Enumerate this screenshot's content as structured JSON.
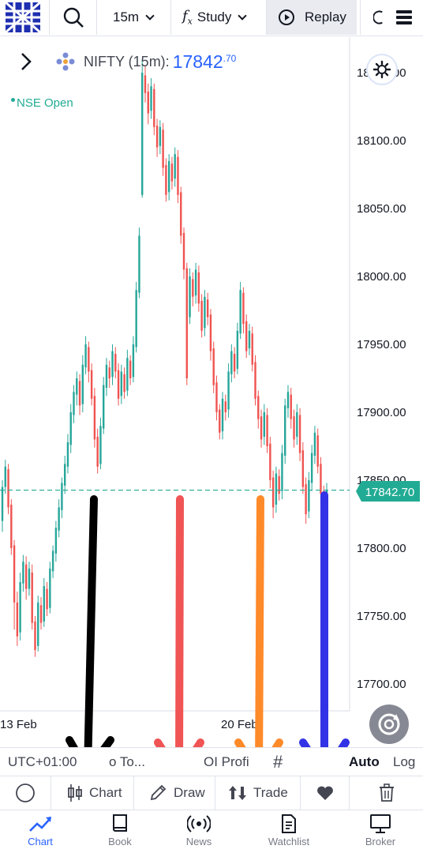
{
  "topbar": {
    "interval": "15m",
    "study_label": "Study",
    "replay_label": "Replay"
  },
  "symbol": {
    "name": "NIFTY (15m):",
    "price_main": "17842",
    "price_decimals": ".70",
    "status": "NSE Open"
  },
  "price_axis": {
    "labels": [
      "18150.00",
      "18100.00",
      "18050.00",
      "18000.00",
      "17950.00",
      "17900.00",
      "17850.00",
      "17800.00",
      "17750.00",
      "17700.00"
    ],
    "current_price_label": "17842.70"
  },
  "time_axis": {
    "labels": [
      "13 Feb",
      "20 Feb"
    ]
  },
  "chart_data": {
    "type": "candlestick",
    "symbol": "NIFTY",
    "interval": "15m",
    "last_price": 17842.7,
    "y_range": [
      17670,
      18200
    ],
    "candles": [
      [
        17820,
        17845,
        17812,
        17850
      ],
      [
        17845,
        17860,
        17840,
        17865
      ],
      [
        17858,
        17830,
        17825,
        17862
      ],
      [
        17832,
        17800,
        17795,
        17836
      ],
      [
        17802,
        17760,
        17740,
        17806
      ],
      [
        17760,
        17735,
        17728,
        17768
      ],
      [
        17738,
        17775,
        17732,
        17782
      ],
      [
        17774,
        17790,
        17768,
        17795
      ],
      [
        17788,
        17770,
        17762,
        17794
      ],
      [
        17770,
        17785,
        17765,
        17790
      ],
      [
        17782,
        17745,
        17740,
        17788
      ],
      [
        17746,
        17725,
        17720,
        17750
      ],
      [
        17728,
        17760,
        17724,
        17765
      ],
      [
        17758,
        17745,
        17740,
        17764
      ],
      [
        17746,
        17772,
        17742,
        17778
      ],
      [
        17770,
        17755,
        17750,
        17775
      ],
      [
        17756,
        17785,
        17752,
        17790
      ],
      [
        17783,
        17798,
        17778,
        17802
      ],
      [
        17796,
        17815,
        17790,
        17820
      ],
      [
        17813,
        17830,
        17808,
        17836
      ],
      [
        17828,
        17848,
        17822,
        17852
      ],
      [
        17846,
        17862,
        17840,
        17868
      ],
      [
        17860,
        17878,
        17855,
        17884
      ],
      [
        17876,
        17900,
        17870,
        17906
      ],
      [
        17898,
        17915,
        17892,
        17920
      ],
      [
        17913,
        17925,
        17905,
        17930
      ],
      [
        17923,
        17905,
        17898,
        17928
      ],
      [
        17906,
        17935,
        17900,
        17942
      ],
      [
        17933,
        17950,
        17928,
        17956
      ],
      [
        17948,
        17930,
        17922,
        17952
      ],
      [
        17931,
        17910,
        17905,
        17936
      ],
      [
        17912,
        17880,
        17874,
        17918
      ],
      [
        17882,
        17860,
        17855,
        17888
      ],
      [
        17862,
        17890,
        17858,
        17896
      ],
      [
        17888,
        17920,
        17884,
        17926
      ],
      [
        17918,
        17935,
        17912,
        17940
      ],
      [
        17933,
        17925,
        17918,
        17938
      ],
      [
        17926,
        17945,
        17920,
        17950
      ],
      [
        17943,
        17930,
        17925,
        17948
      ],
      [
        17931,
        17910,
        17905,
        17936
      ],
      [
        17912,
        17930,
        17906,
        17935
      ],
      [
        17928,
        17915,
        17910,
        17933
      ],
      [
        17916,
        17940,
        17912,
        17946
      ],
      [
        17938,
        17925,
        17920,
        17942
      ],
      [
        17926,
        17950,
        17922,
        17956
      ],
      [
        17948,
        17990,
        17944,
        17996
      ],
      [
        17988,
        18030,
        17984,
        18036
      ],
      [
        18060,
        18150,
        18058,
        18160
      ],
      [
        18148,
        18135,
        18128,
        18155
      ],
      [
        18136,
        18120,
        18112,
        18142
      ],
      [
        18122,
        18140,
        18116,
        18146
      ],
      [
        18138,
        18110,
        18104,
        18142
      ],
      [
        18111,
        18095,
        18088,
        18116
      ],
      [
        18096,
        18110,
        18090,
        18115
      ],
      [
        18108,
        18080,
        18074,
        18113
      ],
      [
        18082,
        18060,
        18055,
        18087
      ],
      [
        18062,
        18085,
        18056,
        18090
      ],
      [
        18083,
        18070,
        18064,
        18088
      ],
      [
        18072,
        18090,
        18066,
        18095
      ],
      [
        18088,
        18060,
        18054,
        18093
      ],
      [
        18062,
        18030,
        18024,
        18066
      ],
      [
        18032,
        18005,
        17998,
        18036
      ],
      [
        18006,
        17925,
        17920,
        18010
      ],
      [
        17970,
        18000,
        17965,
        18006
      ],
      [
        17998,
        17985,
        17978,
        18003
      ],
      [
        17986,
        18005,
        17980,
        18010
      ],
      [
        18003,
        17980,
        17974,
        18008
      ],
      [
        17982,
        17960,
        17955,
        17987
      ],
      [
        17962,
        17985,
        17956,
        17990
      ],
      [
        17983,
        17970,
        17964,
        17988
      ],
      [
        17972,
        17945,
        17938,
        17976
      ],
      [
        17947,
        17920,
        17914,
        17952
      ],
      [
        17922,
        17900,
        17894,
        17927
      ],
      [
        17902,
        17885,
        17880,
        17906
      ],
      [
        17886,
        17910,
        17880,
        17915
      ],
      [
        17908,
        17900,
        17894,
        17913
      ],
      [
        17902,
        17930,
        17896,
        17936
      ],
      [
        17928,
        17945,
        17922,
        17950
      ],
      [
        17943,
        17930,
        17925,
        17948
      ],
      [
        17932,
        17960,
        17928,
        17966
      ],
      [
        17958,
        17990,
        17954,
        17996
      ],
      [
        17988,
        17965,
        17958,
        17992
      ],
      [
        17967,
        17945,
        17940,
        17972
      ],
      [
        17947,
        17960,
        17942,
        17965
      ],
      [
        17958,
        17935,
        17930,
        17963
      ],
      [
        17937,
        17910,
        17905,
        17942
      ],
      [
        17912,
        17895,
        17888,
        17916
      ],
      [
        17897,
        17880,
        17874,
        17902
      ],
      [
        17882,
        17900,
        17876,
        17906
      ],
      [
        17898,
        17875,
        17870,
        17903
      ],
      [
        17877,
        17850,
        17844,
        17882
      ],
      [
        17852,
        17830,
        17822,
        17857
      ],
      [
        17832,
        17855,
        17826,
        17860
      ],
      [
        17853,
        17840,
        17835,
        17858
      ],
      [
        17842,
        17870,
        17836,
        17876
      ],
      [
        17868,
        17905,
        17862,
        17910
      ],
      [
        17903,
        17915,
        17896,
        17920
      ],
      [
        17913,
        17895,
        17888,
        17918
      ],
      [
        17897,
        17880,
        17874,
        17902
      ],
      [
        17882,
        17900,
        17876,
        17906
      ],
      [
        17898,
        17870,
        17864,
        17903
      ],
      [
        17872,
        17845,
        17840,
        17878
      ],
      [
        17847,
        17825,
        17818,
        17852
      ],
      [
        17827,
        17850,
        17822,
        17856
      ],
      [
        17848,
        17870,
        17842,
        17876
      ],
      [
        17868,
        17885,
        17862,
        17890
      ],
      [
        17883,
        17860,
        17855,
        17888
      ],
      [
        17862,
        17840,
        17836,
        17867
      ],
      [
        17842,
        17815,
        17805,
        17846
      ],
      [
        17818,
        17843,
        17810,
        17848
      ]
    ]
  },
  "reset_icon": "reset-chart-icon",
  "timezone_bar": {
    "timezone": "UTC+01:00",
    "goto_label": "o To...",
    "oi_label": "OI Profi",
    "auto_label": "Auto",
    "log_label": "Log"
  },
  "tools": {
    "chart_label": "Chart",
    "draw_label": "Draw",
    "trade_label": "Trade"
  },
  "bottom_nav": {
    "items": [
      {
        "label": "Chart"
      },
      {
        "label": "Book"
      },
      {
        "label": "News"
      },
      {
        "label": "Watchlist"
      },
      {
        "label": "Broker"
      }
    ]
  },
  "annotation_colors": {
    "black": "#000000",
    "red": "#f05454",
    "orange": "#ff8a2a",
    "blue": "#3232e6"
  },
  "colors": {
    "up": "#26a69a",
    "down": "#ef5350",
    "accent": "#2962ff",
    "price_line": "#22ab94"
  }
}
